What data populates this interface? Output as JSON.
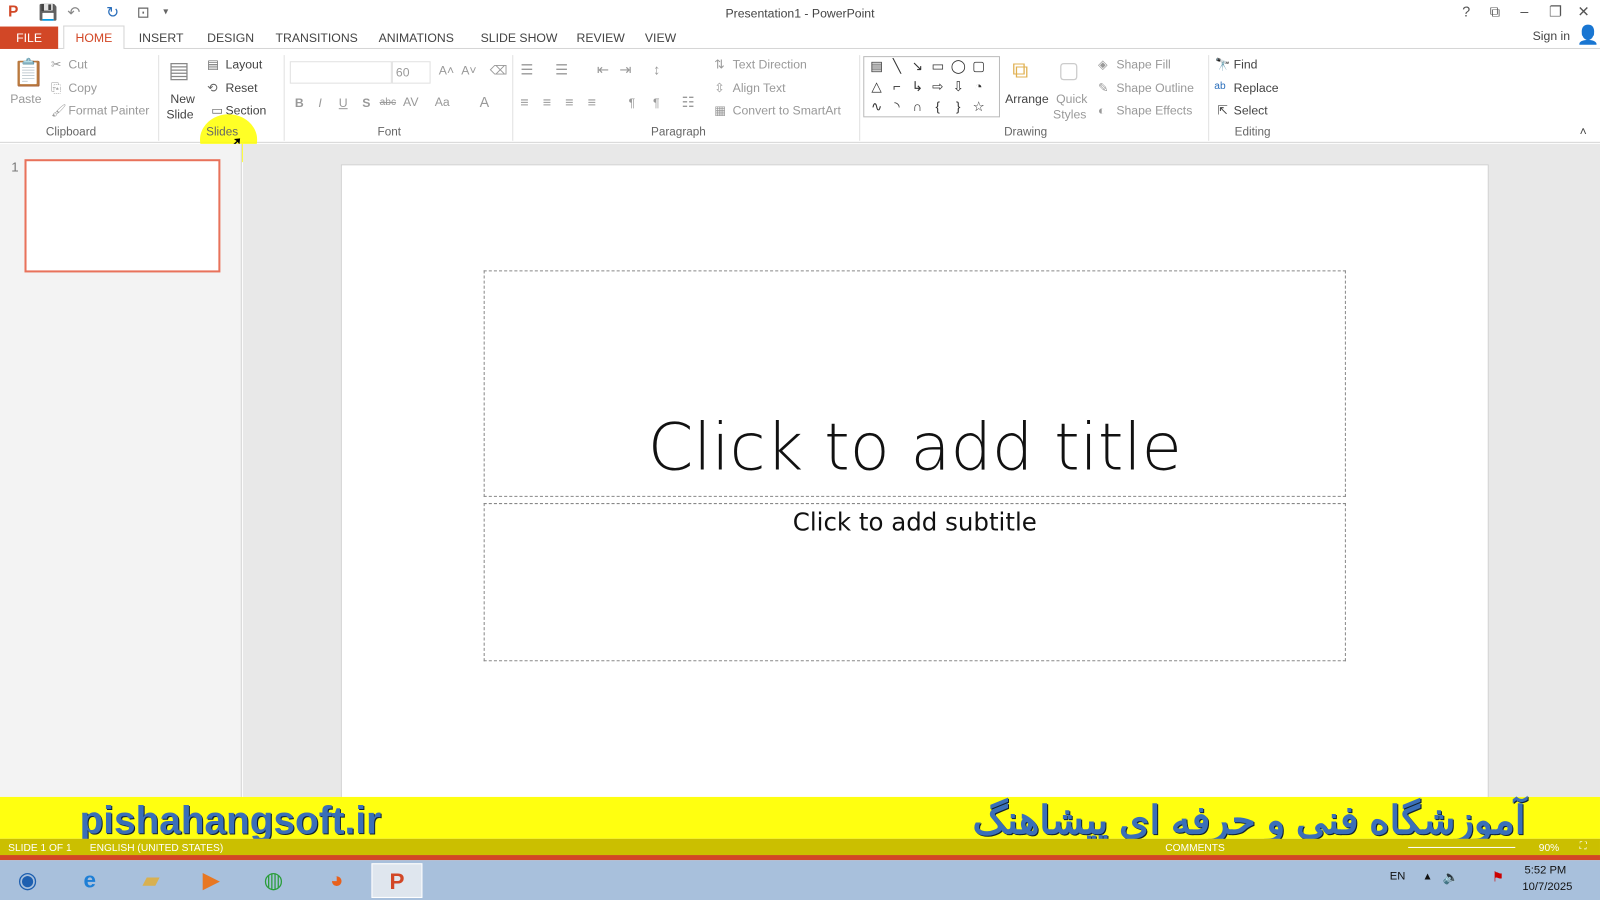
{
  "window": {
    "title": "Presentation1 - PowerPoint",
    "help": "?",
    "sign_in": "Sign in"
  },
  "tabs": [
    "FILE",
    "HOME",
    "INSERT",
    "DESIGN",
    "TRANSITIONS",
    "ANIMATIONS",
    "SLIDE SHOW",
    "REVIEW",
    "VIEW"
  ],
  "clipboard": {
    "paste": "Paste",
    "cut": "Cut",
    "copy": "Copy",
    "format_painter": "Format Painter",
    "label": "Clipboard"
  },
  "slides": {
    "new_slide": "New",
    "new_slide2": "Slide",
    "layout": "Layout",
    "reset": "Reset",
    "section": "Section",
    "label": "Slides"
  },
  "font": {
    "size": "60",
    "label": "Font",
    "buttons": [
      "B",
      "I",
      "U",
      "S",
      "abc",
      "AV",
      "Aa",
      "A"
    ]
  },
  "paragraph": {
    "text_direction": "Text Direction",
    "align_text": "Align Text",
    "convert": "Convert to SmartArt",
    "label": "Paragraph"
  },
  "drawing": {
    "arrange": "Arrange",
    "quick": "Quick",
    "styles": "Styles",
    "shape_fill": "Shape Fill",
    "shape_outline": "Shape Outline",
    "shape_effects": "Shape Effects",
    "label": "Drawing",
    "shapes": [
      "▤",
      "╲",
      "↘",
      "▭",
      "◯",
      "▢",
      "△",
      "⌐",
      "↳",
      "⇨",
      "⇩",
      "◔",
      "∿",
      "◝",
      "∩",
      "{",
      "}",
      "☆"
    ]
  },
  "editing": {
    "find": "Find",
    "replace": "Replace",
    "select": "Select",
    "label": "Editing"
  },
  "thumbnail": {
    "number": "1"
  },
  "slide": {
    "title_placeholder": "Click to add title",
    "subtitle_placeholder": "Click to add subtitle"
  },
  "banner": {
    "url": "pishahangsoft.ir",
    "persian": "آموزشگاه فنی و حرفه ای پیشاهنگ"
  },
  "status": {
    "slide": "SLIDE 1 OF 1",
    "language": "ENGLISH (UNITED STATES)",
    "comments": "COMMENTS",
    "zoom": "90%"
  },
  "tray": {
    "lang": "EN",
    "time": "5:52 PM",
    "date": "10/7/2025"
  },
  "colors": {
    "accent": "#d24726",
    "banner": "#ffff10"
  }
}
